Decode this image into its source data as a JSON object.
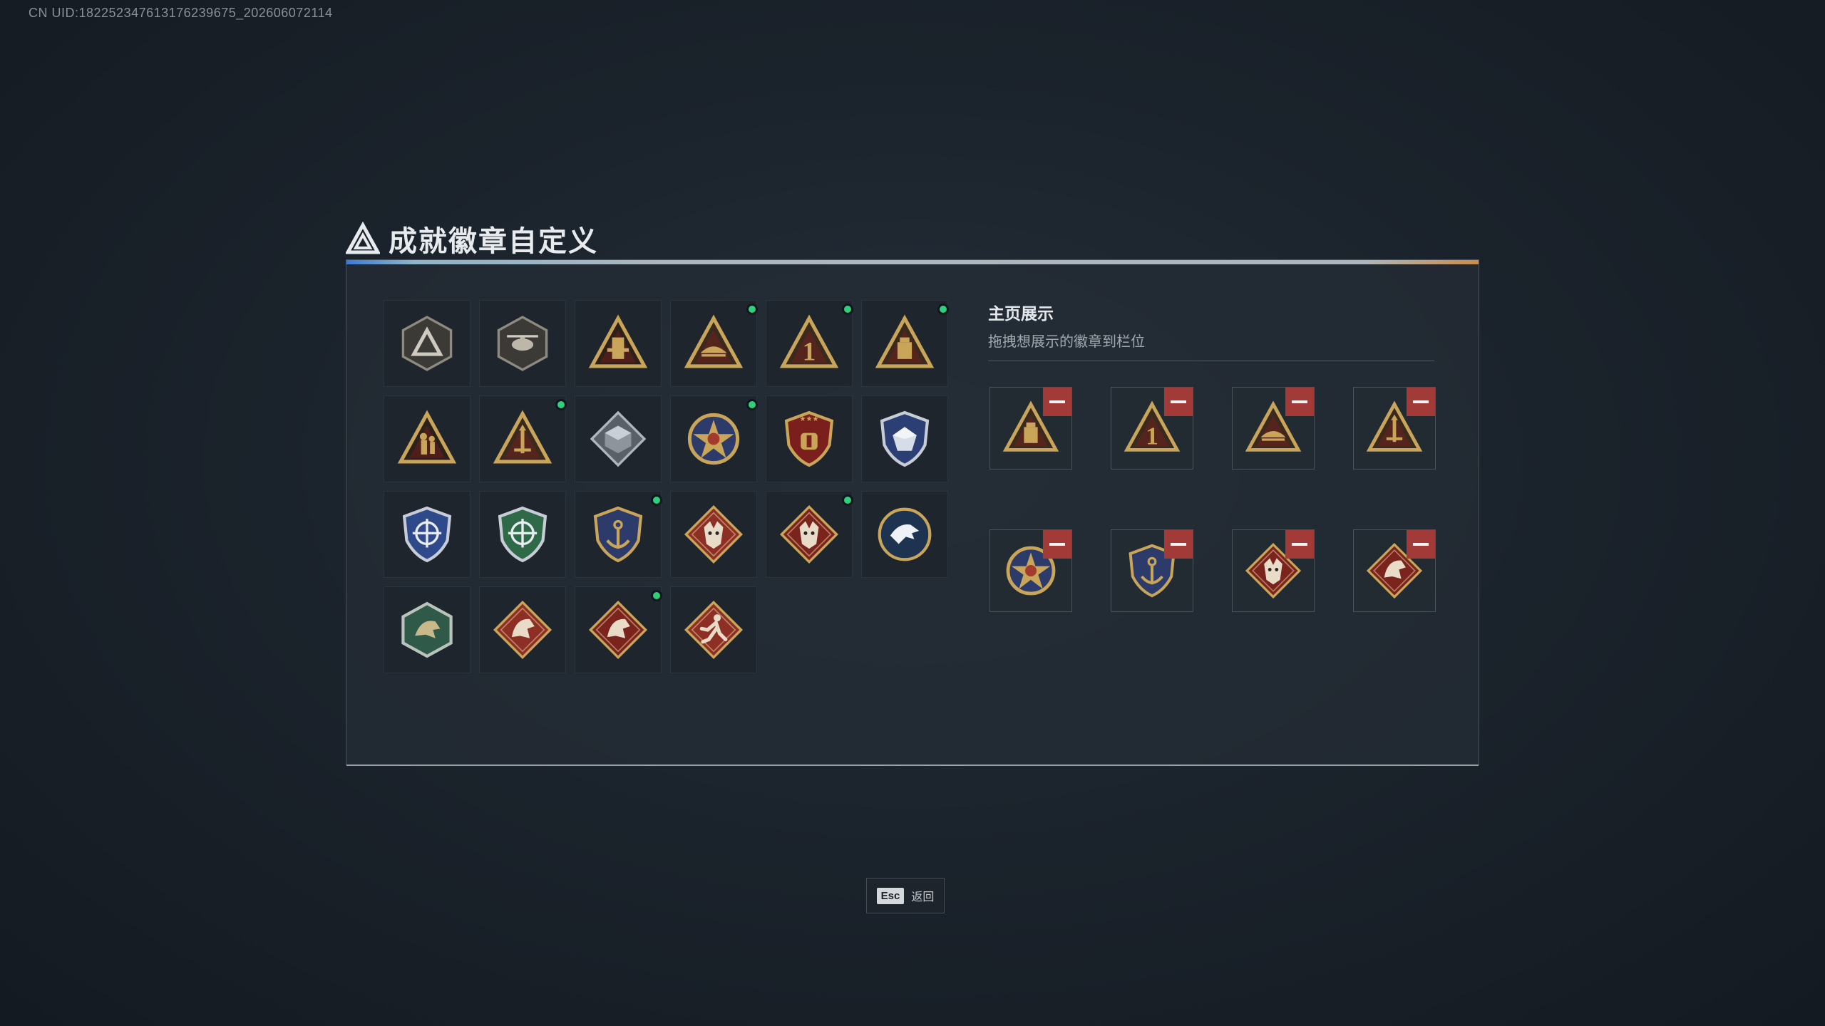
{
  "uid_text": "CN UID:1822523476131762396​75_202606072114",
  "title": "成就徽章自定义",
  "showcase": {
    "title": "主页展示",
    "subtitle": "拖拽想展示的徽章到栏位"
  },
  "badges": [
    {
      "icon": "shield-logo-badge-icon",
      "new": false
    },
    {
      "icon": "helicopter-badge-icon",
      "new": false
    },
    {
      "icon": "tower-badge-icon",
      "new": false
    },
    {
      "icon": "boat-triangle-badge-icon",
      "new": true
    },
    {
      "icon": "number-one-triangle-badge-icon",
      "new": true
    },
    {
      "icon": "cube-triangle-badge-icon",
      "new": true
    },
    {
      "icon": "soldier-triangle-badge-icon",
      "new": false
    },
    {
      "icon": "missile-triangle-badge-icon",
      "new": true
    },
    {
      "icon": "crate-diamond-badge-icon",
      "new": false
    },
    {
      "icon": "star-medal-badge-icon",
      "new": true
    },
    {
      "icon": "stars-shield-badge-icon",
      "new": false
    },
    {
      "icon": "blue-gem-shield-badge-icon",
      "new": false
    },
    {
      "icon": "crosshair-blue-shield-badge-icon",
      "new": false
    },
    {
      "icon": "crosshair-green-shield-badge-icon",
      "new": false
    },
    {
      "icon": "anchor-gold-shield-badge-icon",
      "new": true
    },
    {
      "icon": "wolf-diamond-badge-icon",
      "new": false
    },
    {
      "icon": "wolf-diamond-red-badge-icon",
      "new": true
    },
    {
      "icon": "eagle-circle-badge-icon",
      "new": false
    },
    {
      "icon": "dragon-hexagon-badge-icon",
      "new": false
    },
    {
      "icon": "dragon-diamond-badge-icon",
      "new": false
    },
    {
      "icon": "dragon-diamond-red-badge-icon",
      "new": true
    },
    {
      "icon": "runner-diamond-badge-icon",
      "new": false
    }
  ],
  "slots": [
    {
      "icon": "cube-triangle-badge-icon"
    },
    {
      "icon": "number-one-triangle-badge-icon"
    },
    {
      "icon": "boat-triangle-badge-icon"
    },
    {
      "icon": "missile-triangle-badge-icon"
    },
    {
      "icon": "star-medal-badge-icon"
    },
    {
      "icon": "anchor-gold-shield-badge-icon"
    },
    {
      "icon": "wolf-diamond-red-badge-icon"
    },
    {
      "icon": "dragon-diamond-red-badge-icon"
    }
  ],
  "footer": {
    "esc_key": "Esc",
    "back_label": "返回"
  },
  "colors": {
    "gold": "#c9a55a",
    "dark_red": "#6b1f1c",
    "red_remove": "#a23a38",
    "new_dot": "#2fd07a",
    "panel_bg": "#242c35"
  }
}
